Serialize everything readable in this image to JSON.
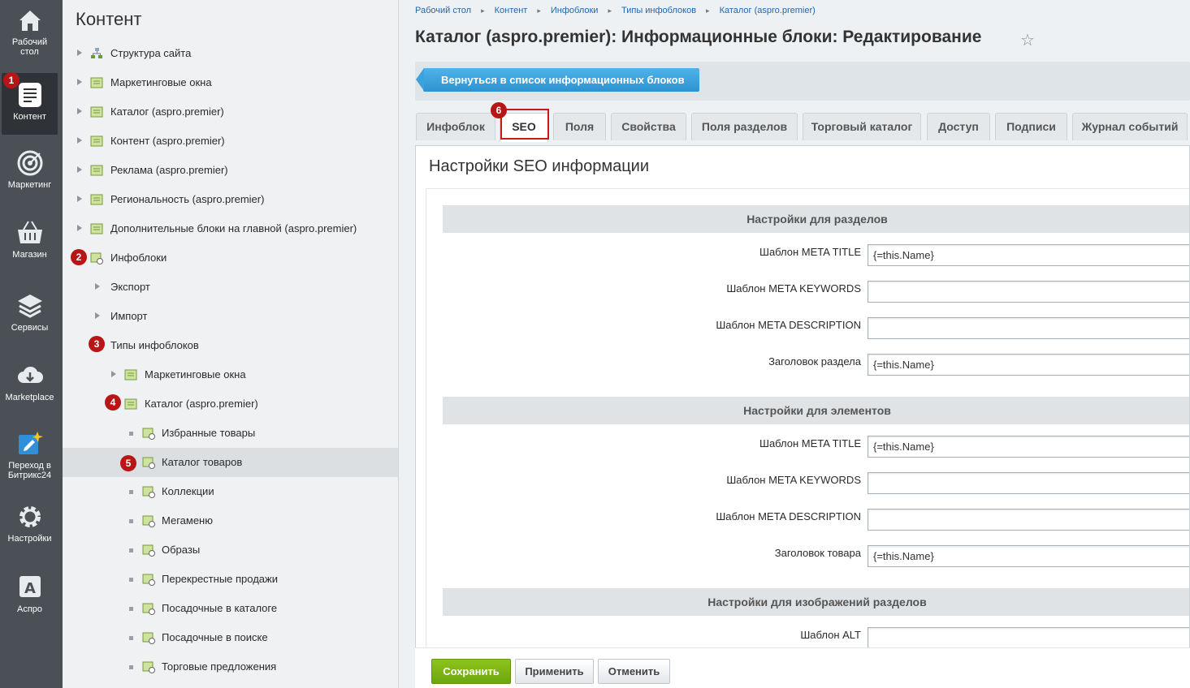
{
  "sidebar": {
    "items": [
      {
        "label": "Рабочий стол",
        "icon": "home-icon"
      },
      {
        "label": "Контент",
        "icon": "document-icon",
        "badge": "1"
      },
      {
        "label": "Маркетинг",
        "icon": "target-icon"
      },
      {
        "label": "Магазин",
        "icon": "basket-icon"
      },
      {
        "label": "Сервисы",
        "icon": "layers-icon"
      },
      {
        "label": "Marketplace",
        "icon": "cloud-download-icon"
      },
      {
        "label": "Переход в Битрикс24",
        "icon": "transfer-icon"
      },
      {
        "label": "Настройки",
        "icon": "gear-icon"
      },
      {
        "label": "Аспро",
        "icon": "aspro-a-icon"
      }
    ]
  },
  "tree": {
    "title": "Контент",
    "nodes": [
      {
        "label": "Структура сайта"
      },
      {
        "label": "Маркетинговые окна"
      },
      {
        "label": "Каталог (aspro.premier)"
      },
      {
        "label": "Контент (aspro.premier)"
      },
      {
        "label": "Реклама (aspro.premier)"
      },
      {
        "label": "Региональность (aspro.premier)"
      },
      {
        "label": "Дополнительные блоки на главной (aspro.premier)"
      },
      {
        "label": "Инфоблоки",
        "badge": "2"
      },
      {
        "label": "Экспорт"
      },
      {
        "label": "Импорт"
      },
      {
        "label": "Типы инфоблоков",
        "badge": "3"
      },
      {
        "label": "Маркетинговые окна"
      },
      {
        "label": "Каталог (aspro.premier)",
        "badge": "4"
      },
      {
        "label": "Избранные товары"
      },
      {
        "label": "Каталог товаров",
        "badge": "5"
      },
      {
        "label": "Коллекции"
      },
      {
        "label": "Мегаменю"
      },
      {
        "label": "Образы"
      },
      {
        "label": "Перекрестные продажи"
      },
      {
        "label": "Посадочные в каталоге"
      },
      {
        "label": "Посадочные в поиске"
      },
      {
        "label": "Торговые предложения"
      }
    ]
  },
  "breadcrumbs": [
    "Рабочий стол",
    "Контент",
    "Инфоблоки",
    "Типы инфоблоков",
    "Каталог (aspro.premier)"
  ],
  "page": {
    "title": "Каталог (aspro.premier): Информационные блоки: Редактирование"
  },
  "back_button": "Вернуться в список информационных блоков",
  "tabs": [
    {
      "label": "Инфоблок"
    },
    {
      "label": "SEO",
      "badge": "6",
      "active": true
    },
    {
      "label": "Поля"
    },
    {
      "label": "Свойства"
    },
    {
      "label": "Поля разделов"
    },
    {
      "label": "Торговый каталог"
    },
    {
      "label": "Доступ"
    },
    {
      "label": "Подписи"
    },
    {
      "label": "Журнал событий"
    }
  ],
  "panel": {
    "title": "Настройки SEO информации",
    "sections": [
      {
        "title": "Настройки для разделов",
        "fields": [
          {
            "label": "Шаблон META TITLE",
            "value": "{=this.Name}"
          },
          {
            "label": "Шаблон META KEYWORDS",
            "value": ""
          },
          {
            "label": "Шаблон META DESCRIPTION",
            "value": ""
          },
          {
            "label": "Заголовок раздела",
            "value": "{=this.Name}"
          }
        ]
      },
      {
        "title": "Настройки для элементов",
        "fields": [
          {
            "label": "Шаблон META TITLE",
            "value": "{=this.Name}"
          },
          {
            "label": "Шаблон META KEYWORDS",
            "value": ""
          },
          {
            "label": "Шаблон META DESCRIPTION",
            "value": ""
          },
          {
            "label": "Заголовок товара",
            "value": "{=this.Name}"
          }
        ]
      },
      {
        "title": "Настройки для изображений разделов",
        "fields": [
          {
            "label": "Шаблон ALT",
            "value": ""
          }
        ]
      }
    ]
  },
  "footer": {
    "save": "Сохранить",
    "apply": "Применить",
    "cancel": "Отменить"
  },
  "colors": {
    "annotation": "#c41b1b",
    "save": "#7ab317",
    "primary": "#2d93d1",
    "rail": "#4a5056"
  }
}
